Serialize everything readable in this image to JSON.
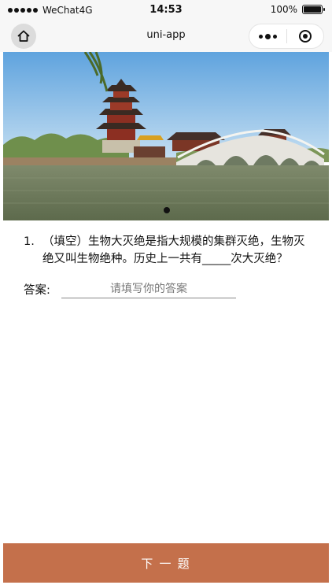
{
  "status_bar": {
    "carrier": "WeChat4G",
    "time": "14:53",
    "battery": "100%",
    "battery_level": 1.0
  },
  "nav": {
    "title": "uni-app"
  },
  "carousel": {
    "image_icon": "pagoda-lake-bridge-photo",
    "slide_count": 1,
    "active_index": 0
  },
  "question": {
    "number": "1.",
    "text": "（填空）生物大灭绝是指大规模的集群灭绝，生物灭绝又叫生物绝种。历史上一共有_____次大灭绝？"
  },
  "answer": {
    "label": "答案:",
    "placeholder": "请填写你的答案",
    "value": ""
  },
  "next_button": {
    "label": "下 一 题"
  },
  "colors": {
    "accent": "#c4704b",
    "nav_bg": "#f7f7f7"
  }
}
